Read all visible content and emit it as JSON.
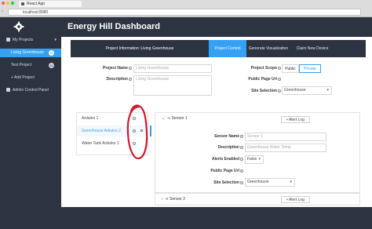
{
  "browser": {
    "tab_title": "React App",
    "url": "localhost:8080",
    "traffic_colors": [
      "#ff5f56",
      "#ffbd2e",
      "#27c93f"
    ]
  },
  "sidebar": {
    "section_label": "My Projects",
    "items": [
      {
        "label": "Living Greenhouse",
        "badge": "10"
      },
      {
        "label": "Test Project",
        "badge": "10"
      },
      {
        "label": "+ Add Project"
      }
    ],
    "admin_label": "Admin Control Panel"
  },
  "header": {
    "title": "Energy Hill Dashboard"
  },
  "project_tabs": {
    "info": "Project Information: Living Greenhouse",
    "tabs": [
      "Project Control",
      "Generate Visualization",
      "Claim New Device"
    ],
    "active_index": 0
  },
  "project_form": {
    "name_label": "Project Name",
    "name_placeholder": "Living Greenhouse",
    "description_label": "Description",
    "description_placeholder": "Living Greenhouse",
    "scope_label": "Project Scope",
    "scope_options": [
      "Public",
      "Private"
    ],
    "scope_selected": "Private",
    "public_url_label": "Public Page Url",
    "site_selection_label": "Site Selection",
    "site_selection_value": "Greenhouse"
  },
  "devices": [
    {
      "label": "Arduino 1",
      "selected": false
    },
    {
      "label": "Greenhouse Adruino 2",
      "selected": true
    },
    {
      "label": "Water Tank Arduino 1",
      "selected": false
    }
  ],
  "sensor1": {
    "title": "Sensor 1",
    "alert_log": "Alert Log",
    "name_label": "Sensor Name",
    "name_placeholder": "Sensor 1",
    "description_label": "Description",
    "description_placeholder": "Greenhouse Water Temp",
    "alerts_label": "Alerts Enabled",
    "alerts_value": "False",
    "public_url_label": "Public Page Url",
    "site_selection_label": "Site Selection",
    "site_selection_value": "Greenhouse"
  },
  "sensor2": {
    "title": "Sensor 2",
    "alert_log": "Alert Log"
  },
  "colors": {
    "accent": "#35a1f4",
    "sidebar": "#2c3341",
    "annotation": "#d0192e"
  }
}
